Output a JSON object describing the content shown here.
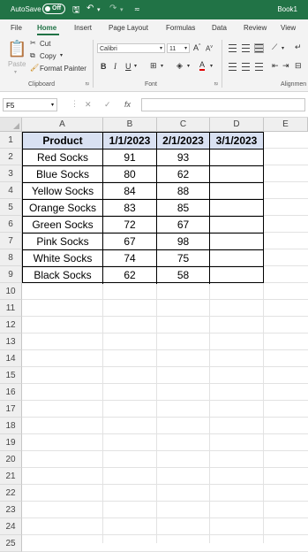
{
  "titlebar": {
    "autosave_label": "AutoSave",
    "autosave_state": "Off",
    "book_name": "Book1"
  },
  "tabs": [
    "File",
    "Home",
    "Insert",
    "Page Layout",
    "Formulas",
    "Data",
    "Review",
    "View"
  ],
  "ribbon": {
    "clipboard": {
      "paste": "Paste",
      "cut": "Cut",
      "copy": "Copy",
      "format_painter": "Format Painter",
      "label": "Clipboard"
    },
    "font": {
      "name": "Calibri",
      "size": "11",
      "bold": "B",
      "italic": "I",
      "underline": "U",
      "grow": "A",
      "shrink": "A",
      "color_icon": "A",
      "label": "Font"
    },
    "alignment": {
      "label": "Alignmen"
    }
  },
  "formula_bar": {
    "name_box": "F5",
    "fx": "fx",
    "formula": ""
  },
  "columns": [
    "A",
    "B",
    "C",
    "D",
    "E"
  ],
  "rows": [
    "1",
    "2",
    "3",
    "4",
    "5",
    "6",
    "7",
    "8",
    "9",
    "10",
    "11",
    "12",
    "13",
    "14",
    "15",
    "16",
    "17",
    "18",
    "19",
    "20",
    "21",
    "22",
    "23",
    "24",
    "25"
  ],
  "sheet": {
    "header": [
      "Product",
      "1/1/2023",
      "2/1/2023",
      "3/1/2023"
    ],
    "data": [
      [
        "Red Socks",
        "91",
        "93",
        ""
      ],
      [
        "Blue Socks",
        "80",
        "62",
        ""
      ],
      [
        "Yellow Socks",
        "84",
        "88",
        ""
      ],
      [
        "Orange Socks",
        "83",
        "85",
        ""
      ],
      [
        "Green Socks",
        "72",
        "67",
        ""
      ],
      [
        "Pink Socks",
        "67",
        "98",
        ""
      ],
      [
        "White Socks",
        "74",
        "75",
        ""
      ],
      [
        "Black Socks",
        "62",
        "58",
        ""
      ]
    ]
  },
  "colors": {
    "excel_green": "#217346",
    "header_fill": "#d9e1f2",
    "font_color_bar": "#e00000"
  }
}
